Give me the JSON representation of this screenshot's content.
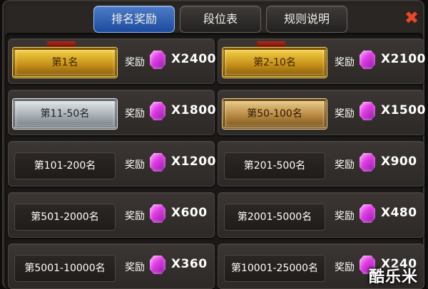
{
  "tabs": [
    "排名奖励",
    "段位表",
    "规则说明"
  ],
  "close_icon": "close-icon",
  "reward_label": "奖励",
  "gem_icon": "purple-gem-icon",
  "rows": [
    {
      "rank": "第1名",
      "amount": "X2400",
      "style": "gold"
    },
    {
      "rank": "第2-10名",
      "amount": "X2100",
      "style": "gold"
    },
    {
      "rank": "第11-50名",
      "amount": "X1800",
      "style": "silver"
    },
    {
      "rank": "第50-100名",
      "amount": "X1500",
      "style": "bronze"
    },
    {
      "rank": "第101-200名",
      "amount": "X1200",
      "style": "plain"
    },
    {
      "rank": "第201-500名",
      "amount": "X900",
      "style": "plain"
    },
    {
      "rank": "第501-2000名",
      "amount": "X600",
      "style": "plain"
    },
    {
      "rank": "第2001-5000名",
      "amount": "X480",
      "style": "plain"
    },
    {
      "rank": "第5001-10000名",
      "amount": "X360",
      "style": "plain"
    },
    {
      "rank": "第10001-25000名",
      "amount": "X240",
      "style": "plain"
    }
  ],
  "watermark": "酷乐米",
  "colors": {
    "active_tab": "#2f63b8",
    "gold": "#d9a52b",
    "silver": "#b7bdc2",
    "bronze": "#c39b57",
    "gem": "#d630da",
    "close": "#e14a2a"
  }
}
